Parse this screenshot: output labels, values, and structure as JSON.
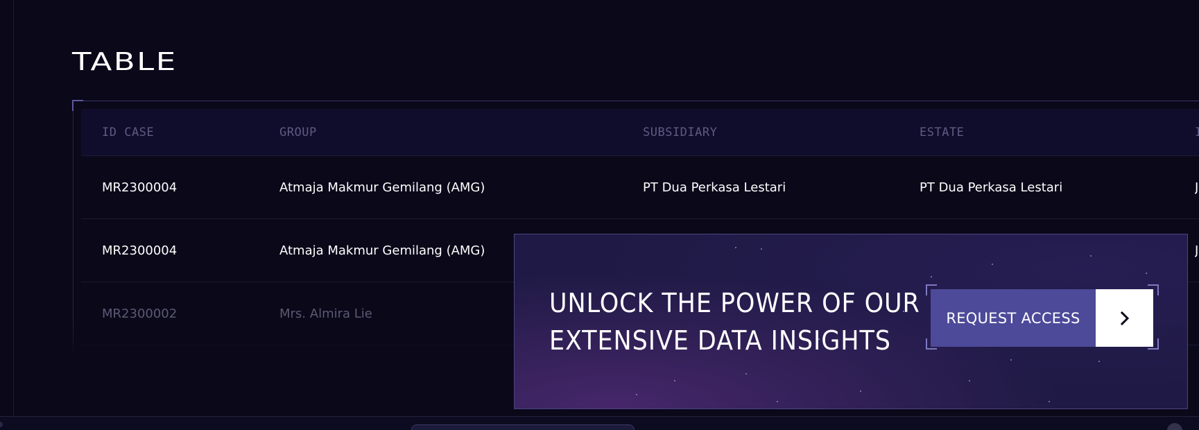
{
  "section": {
    "title": "TABLE"
  },
  "table": {
    "columns": [
      "ID CASE",
      "GROUP",
      "SUBSIDIARY",
      "ESTATE",
      "I"
    ],
    "rows": [
      {
        "id_case": "MR2300004",
        "group": "Atmaja Makmur Gemilang (AMG)",
        "subsidiary": "PT Dua Perkasa Lestari",
        "estate": "PT Dua Perkasa Lestari",
        "extra": "J"
      },
      {
        "id_case": "MR2300004",
        "group": "Atmaja Makmur Gemilang (AMG)",
        "subsidiary": "",
        "estate": "",
        "extra": "J"
      },
      {
        "id_case": "MR2300002",
        "group": "Mrs. Almira Lie",
        "subsidiary": "",
        "estate": "",
        "extra": ""
      }
    ]
  },
  "cta": {
    "line1": "UNLOCK THE POWER OF OUR",
    "line2": "EXTENSIVE DATA INSIGHTS",
    "button_label": "REQUEST ACCESS",
    "button_icon": "chevron-right-icon"
  },
  "colors": {
    "background": "#0a0819",
    "accent": "#4d4a9a",
    "panel": "#1f1a45"
  }
}
